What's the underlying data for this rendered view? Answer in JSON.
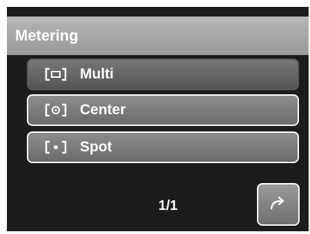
{
  "title": "Metering",
  "items": [
    {
      "label": "Multi",
      "icon": "metering-multi-icon",
      "selected": true
    },
    {
      "label": "Center",
      "icon": "metering-center-icon",
      "selected": false
    },
    {
      "label": "Spot",
      "icon": "metering-spot-icon",
      "selected": false
    }
  ],
  "pagination": {
    "page": "1/1"
  },
  "return_button": {
    "icon": "return-arrow-icon"
  }
}
